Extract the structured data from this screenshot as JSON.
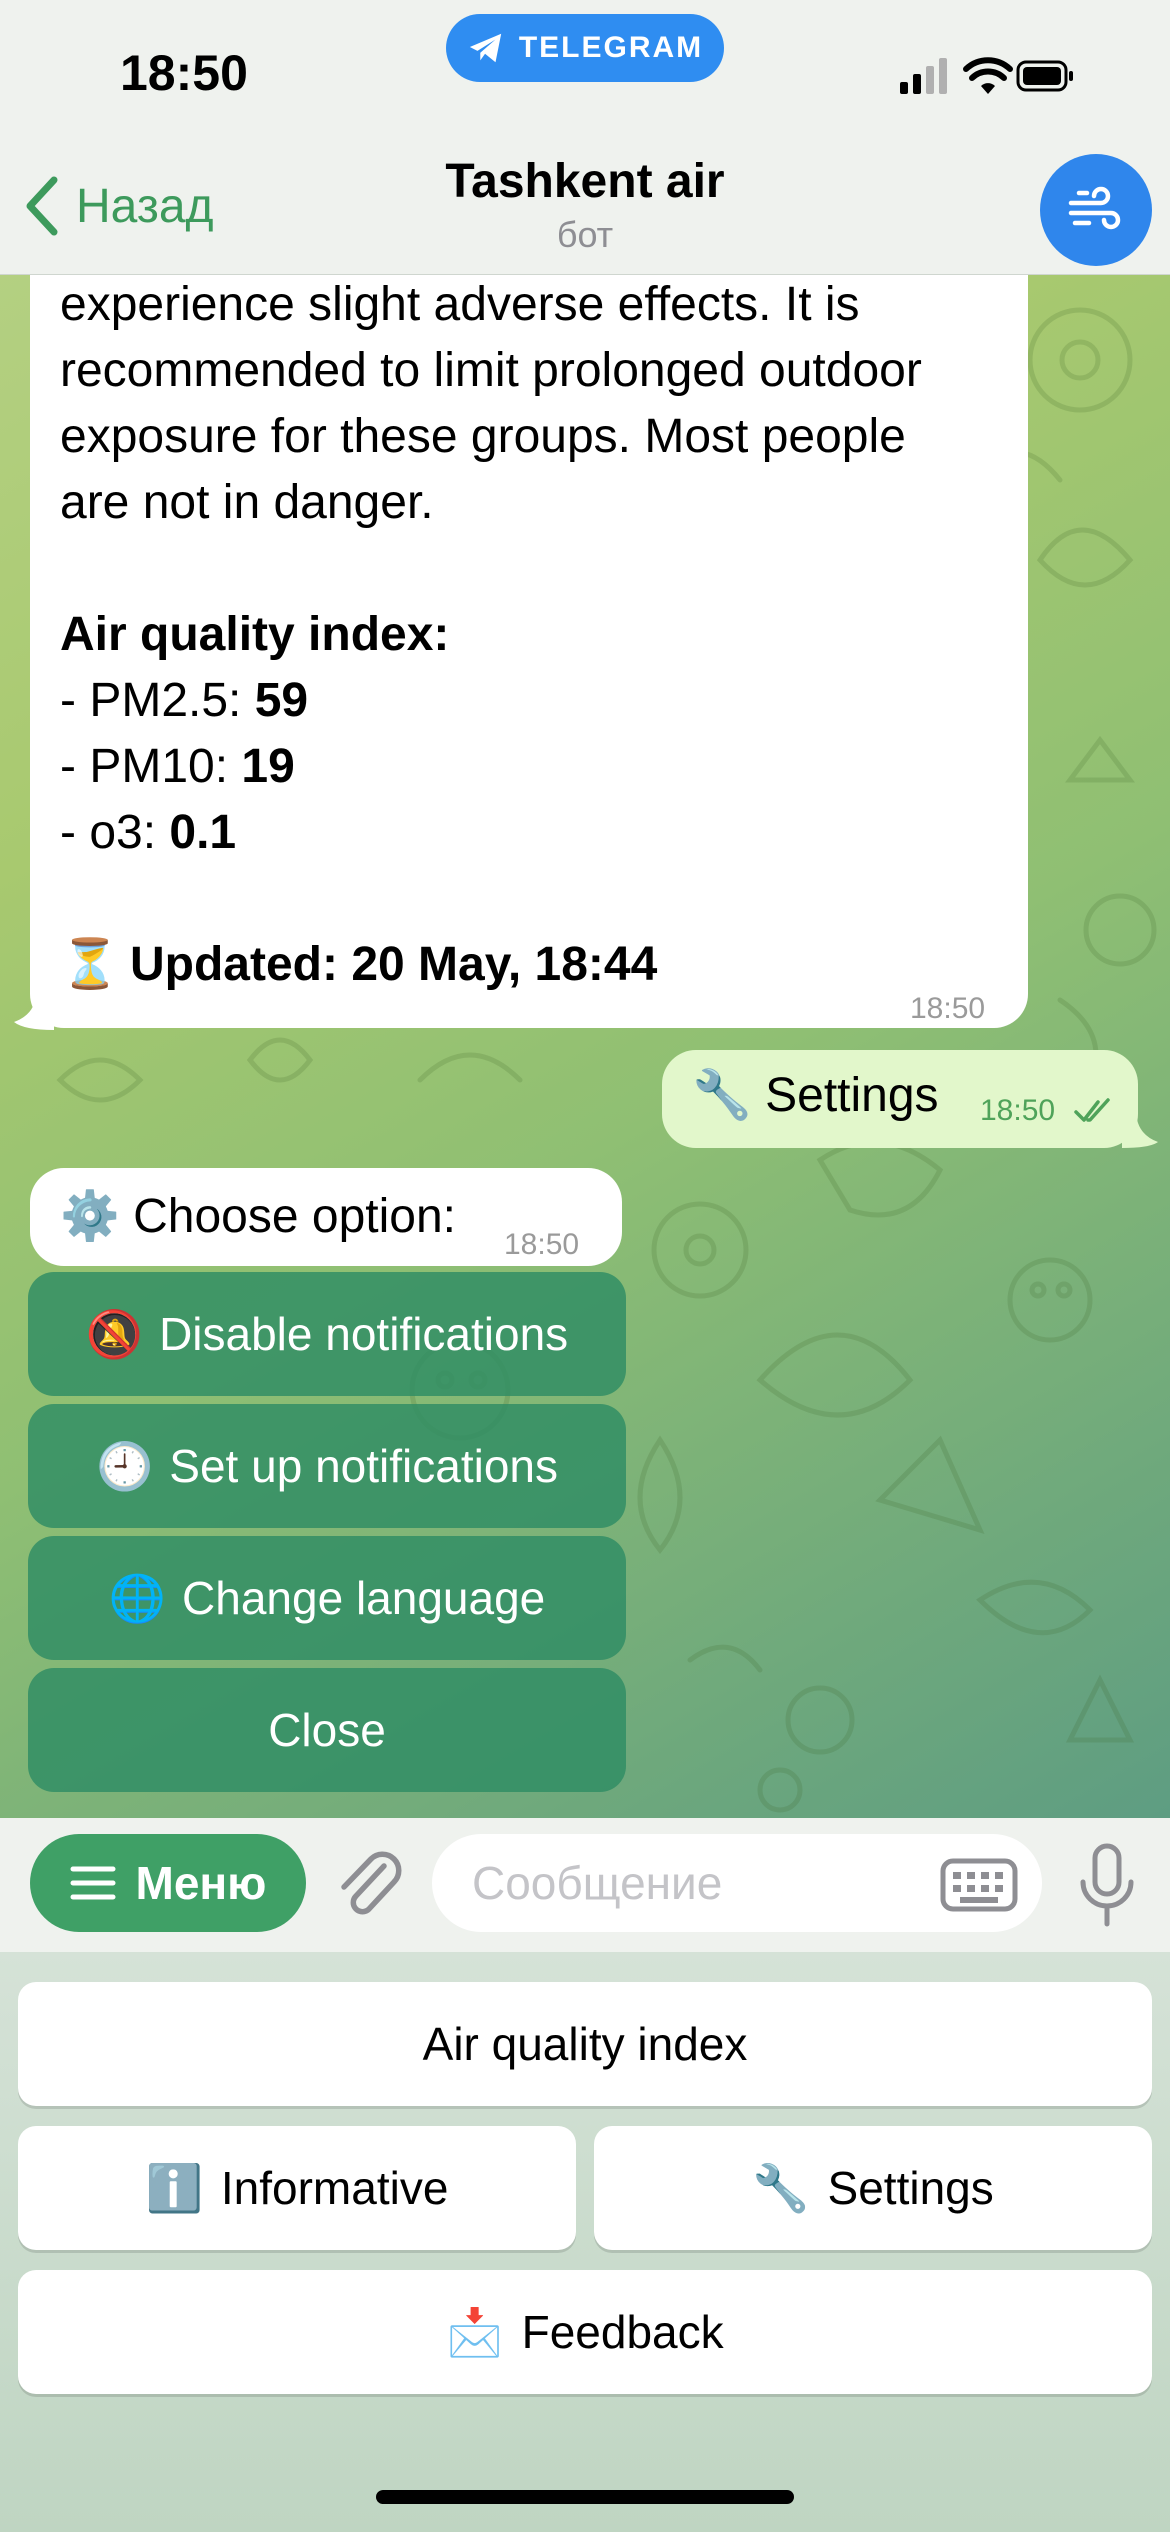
{
  "status_bar": {
    "time": "18:50",
    "app_pill": "TELEGRAM"
  },
  "header": {
    "back_label": "Назад",
    "title": "Tashkent air",
    "subtitle": "бот"
  },
  "messages": {
    "aqi_report": {
      "lines": [
        "experience slight adverse effects. It is",
        "recommended to limit prolonged outdoor",
        "exposure for these groups. Most people",
        "are not in danger."
      ],
      "index_heading": "Air quality index:",
      "pm25_label": "- PM2.5: ",
      "pm25_value": "59",
      "pm10_label": "- PM10: ",
      "pm10_value": "19",
      "o3_label": "- o3: ",
      "o3_value": "0.1",
      "updated_icon": "⏳",
      "updated": "Updated: 20 May, 18:44",
      "time": "18:50"
    },
    "settings_out": {
      "icon": "🔧",
      "text": "Settings",
      "time": "18:50"
    },
    "choose": {
      "icon": "⚙️",
      "text": "Choose option:",
      "time": "18:50"
    }
  },
  "inline_keyboard": [
    {
      "icon": "🔕",
      "label": "Disable notifications"
    },
    {
      "icon": "🕘",
      "label": "Set up notifications"
    },
    {
      "icon": "🌐",
      "label": "Change language"
    },
    {
      "icon": "",
      "label": "Close"
    }
  ],
  "composer": {
    "menu_label": "Меню",
    "placeholder": "Сообщение"
  },
  "reply_keyboard": {
    "air_quality": "Air quality index",
    "informative_icon": "ℹ️",
    "informative": "Informative",
    "settings_icon": "🔧",
    "settings": "Settings",
    "feedback_icon": "📩",
    "feedback": "Feedback"
  },
  "colors": {
    "accent_green": "#3fa066",
    "telegram_blue": "#2f8df1",
    "outgoing_bubble": "#e2f7cb",
    "inline_button": "#2e8c64"
  }
}
